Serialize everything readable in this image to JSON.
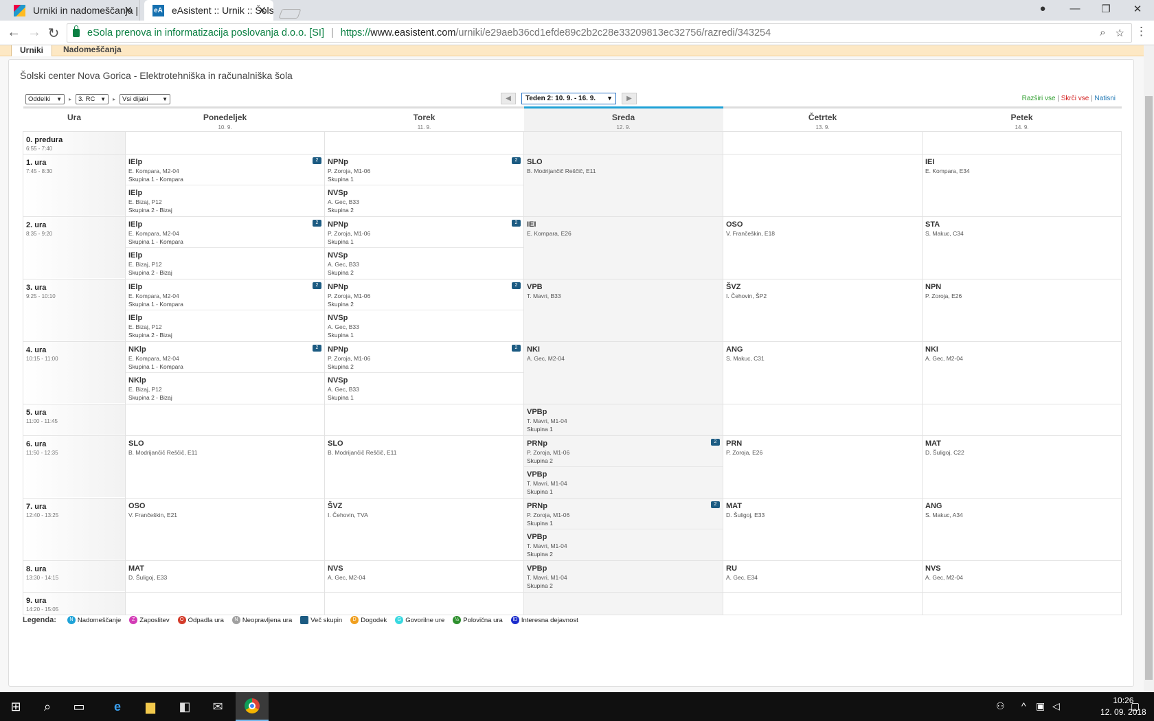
{
  "browser": {
    "tabs": [
      {
        "title": "Urniki in nadomeščanja |",
        "favicon": "school-favicon"
      },
      {
        "title": "eAsistent :: Urnik :: Šolski",
        "favicon": "eA"
      }
    ],
    "address": {
      "site_owner": "eSola prenova in informatizacija poslovanja d.o.o. [SI]",
      "scheme": "https://",
      "host": "www.easistent.com",
      "path": "/urniki/e29aeb36cd1efde89c2b2c28e33209813ec32756/razredi/343254"
    }
  },
  "page": {
    "nav_tabs": [
      "Urniki",
      "Nadomeščanja"
    ],
    "school": "Šolski center Nova Gorica - Elektrotehniška in računalniška šola",
    "filters": {
      "view": "Oddelki",
      "class": "3. RC",
      "students": "Vsi dijaki"
    },
    "week": "Teden 2: 10. 9. - 16. 9.",
    "actions": {
      "expand": "Razširi vse",
      "collapse": "Skrči vse",
      "print": "Natisni",
      "sep": "|"
    }
  },
  "timetable": {
    "hour_header": "Ura",
    "days": [
      {
        "name": "Ponedeljek",
        "date": "10. 9."
      },
      {
        "name": "Torek",
        "date": "11. 9."
      },
      {
        "name": "Sreda",
        "date": "12. 9.",
        "today": true
      },
      {
        "name": "Četrtek",
        "date": "13. 9."
      },
      {
        "name": "Petek",
        "date": "14. 9."
      }
    ],
    "periods": [
      {
        "name": "0. predura",
        "time": "6:55 - 7:40",
        "cells": [
          [],
          [],
          [],
          [],
          []
        ]
      },
      {
        "name": "1. ura",
        "time": "7:45 - 8:30",
        "cells": [
          [
            {
              "s": "IElp",
              "t": "E. Kompara, M2-04",
              "g": "Skupina 1 - Kompara",
              "m": true
            },
            {
              "s": "IElp",
              "t": "E. Bizaj, P12",
              "g": "Skupina 2 - Bizaj"
            }
          ],
          [
            {
              "s": "NPNp",
              "t": "P. Zoroja, M1-06",
              "g": "Skupina 1",
              "m": true
            },
            {
              "s": "NVSp",
              "t": "A. Gec, B33",
              "g": "Skupina 2"
            }
          ],
          [
            {
              "s": "SLO",
              "t": "B. Modrijančič Reščič, E11"
            }
          ],
          [],
          [
            {
              "s": "IEI",
              "t": "E. Kompara, E34"
            }
          ]
        ]
      },
      {
        "name": "2. ura",
        "time": "8:35 - 9:20",
        "cells": [
          [
            {
              "s": "IElp",
              "t": "E. Kompara, M2-04",
              "g": "Skupina 1 - Kompara",
              "m": true
            },
            {
              "s": "IElp",
              "t": "E. Bizaj, P12",
              "g": "Skupina 2 - Bizaj"
            }
          ],
          [
            {
              "s": "NPNp",
              "t": "P. Zoroja, M1-06",
              "g": "Skupina 1",
              "m": true
            },
            {
              "s": "NVSp",
              "t": "A. Gec, B33",
              "g": "Skupina 2"
            }
          ],
          [
            {
              "s": "IEI",
              "t": "E. Kompara, E26"
            }
          ],
          [
            {
              "s": "OSO",
              "t": "V. Frančeškin, E18"
            }
          ],
          [
            {
              "s": "STA",
              "t": "S. Makuc, C34"
            }
          ]
        ]
      },
      {
        "name": "3. ura",
        "time": "9:25 - 10:10",
        "cells": [
          [
            {
              "s": "IElp",
              "t": "E. Kompara, M2-04",
              "g": "Skupina 1 - Kompara",
              "m": true
            },
            {
              "s": "IElp",
              "t": "E. Bizaj, P12",
              "g": "Skupina 2 - Bizaj"
            }
          ],
          [
            {
              "s": "NPNp",
              "t": "P. Zoroja, M1-06",
              "g": "Skupina 2",
              "m": true
            },
            {
              "s": "NVSp",
              "t": "A. Gec, B33",
              "g": "Skupina 1"
            }
          ],
          [
            {
              "s": "VPB",
              "t": "T. Mavri, B33"
            }
          ],
          [
            {
              "s": "ŠVZ",
              "t": "I. Čehovin, ŠP2"
            }
          ],
          [
            {
              "s": "NPN",
              "t": "P. Zoroja, E26"
            }
          ]
        ]
      },
      {
        "name": "4. ura",
        "time": "10:15 - 11:00",
        "cells": [
          [
            {
              "s": "NKlp",
              "t": "E. Kompara, M2-04",
              "g": "Skupina 1 - Kompara",
              "m": true
            },
            {
              "s": "NKlp",
              "t": "E. Bizaj, P12",
              "g": "Skupina 2 - Bizaj"
            }
          ],
          [
            {
              "s": "NPNp",
              "t": "P. Zoroja, M1-06",
              "g": "Skupina 2",
              "m": true
            },
            {
              "s": "NVSp",
              "t": "A. Gec, B33",
              "g": "Skupina 1"
            }
          ],
          [
            {
              "s": "NKI",
              "t": "A. Gec, M2-04"
            }
          ],
          [
            {
              "s": "ANG",
              "t": "S. Makuc, C31"
            }
          ],
          [
            {
              "s": "NKI",
              "t": "A. Gec, M2-04"
            }
          ]
        ]
      },
      {
        "name": "5. ura",
        "time": "11:00 - 11:45",
        "cells": [
          [],
          [],
          [
            {
              "s": "VPBp",
              "t": "T. Mavri, M1-04",
              "g": "Skupina 1"
            }
          ],
          [],
          []
        ]
      },
      {
        "name": "6. ura",
        "time": "11:50 - 12:35",
        "cells": [
          [
            {
              "s": "SLO",
              "t": "B. Modrijančič Reščič, E11"
            }
          ],
          [
            {
              "s": "SLO",
              "t": "B. Modrijančič Reščič, E11"
            }
          ],
          [
            {
              "s": "PRNp",
              "t": "P. Zoroja, M1-06",
              "g": "Skupina 2",
              "m": true
            },
            {
              "s": "VPBp",
              "t": "T. Mavri, M1-04",
              "g": "Skupina 1"
            }
          ],
          [
            {
              "s": "PRN",
              "t": "P. Zoroja, E26"
            }
          ],
          [
            {
              "s": "MAT",
              "t": "D. Šuligoj, C22"
            }
          ]
        ]
      },
      {
        "name": "7. ura",
        "time": "12:40 - 13:25",
        "cells": [
          [
            {
              "s": "OSO",
              "t": "V. Frančeškin, E21"
            }
          ],
          [
            {
              "s": "ŠVZ",
              "t": "I. Čehovin, TVA"
            }
          ],
          [
            {
              "s": "PRNp",
              "t": "P. Zoroja, M1-06",
              "g": "Skupina 1",
              "m": true
            },
            {
              "s": "VPBp",
              "t": "T. Mavri, M1-04",
              "g": "Skupina 2"
            }
          ],
          [
            {
              "s": "MAT",
              "t": "D. Šuligoj, E33"
            }
          ],
          [
            {
              "s": "ANG",
              "t": "S. Makuc, A34"
            }
          ]
        ]
      },
      {
        "name": "8. ura",
        "time": "13:30 - 14:15",
        "cells": [
          [
            {
              "s": "MAT",
              "t": "D. Šuligoj, E33"
            }
          ],
          [
            {
              "s": "NVS",
              "t": "A. Gec, M2-04"
            }
          ],
          [
            {
              "s": "VPBp",
              "t": "T. Mavri, M1-04",
              "g": "Skupina 2"
            }
          ],
          [
            {
              "s": "RU",
              "t": "A. Gec, E34"
            }
          ],
          [
            {
              "s": "NVS",
              "t": "A. Gec, M2-04"
            }
          ]
        ]
      },
      {
        "name": "9. ura",
        "time": "14:20 - 15:05",
        "cells": [
          [],
          [],
          [],
          [],
          []
        ]
      }
    ],
    "multi_badge": "2"
  },
  "legend": {
    "title": "Legenda:",
    "items": [
      {
        "label": "Nadomeščanje",
        "letter": "N",
        "color": "#1fa3d8"
      },
      {
        "label": "Zaposlitev",
        "letter": "Z",
        "color": "#d33bb6"
      },
      {
        "label": "Odpadla ura",
        "letter": "O",
        "color": "#d43b2a"
      },
      {
        "label": "Neopravljena ura",
        "letter": "N",
        "color": "#a0a0a0"
      },
      {
        "label": "Več skupin",
        "letter": "",
        "color": "#1c5b82"
      },
      {
        "label": "Dogodek",
        "letter": "D",
        "color": "#f0a020"
      },
      {
        "label": "Govorilne ure",
        "letter": "G",
        "color": "#38d8e0"
      },
      {
        "label": "Polovična ura",
        "letter": "½",
        "color": "#2d8f2d"
      },
      {
        "label": "Interesna dejavnost",
        "letter": "ID",
        "color": "#1c2dcc"
      }
    ]
  },
  "taskbar": {
    "time": "10:26",
    "date": "12. 09. 2018"
  }
}
